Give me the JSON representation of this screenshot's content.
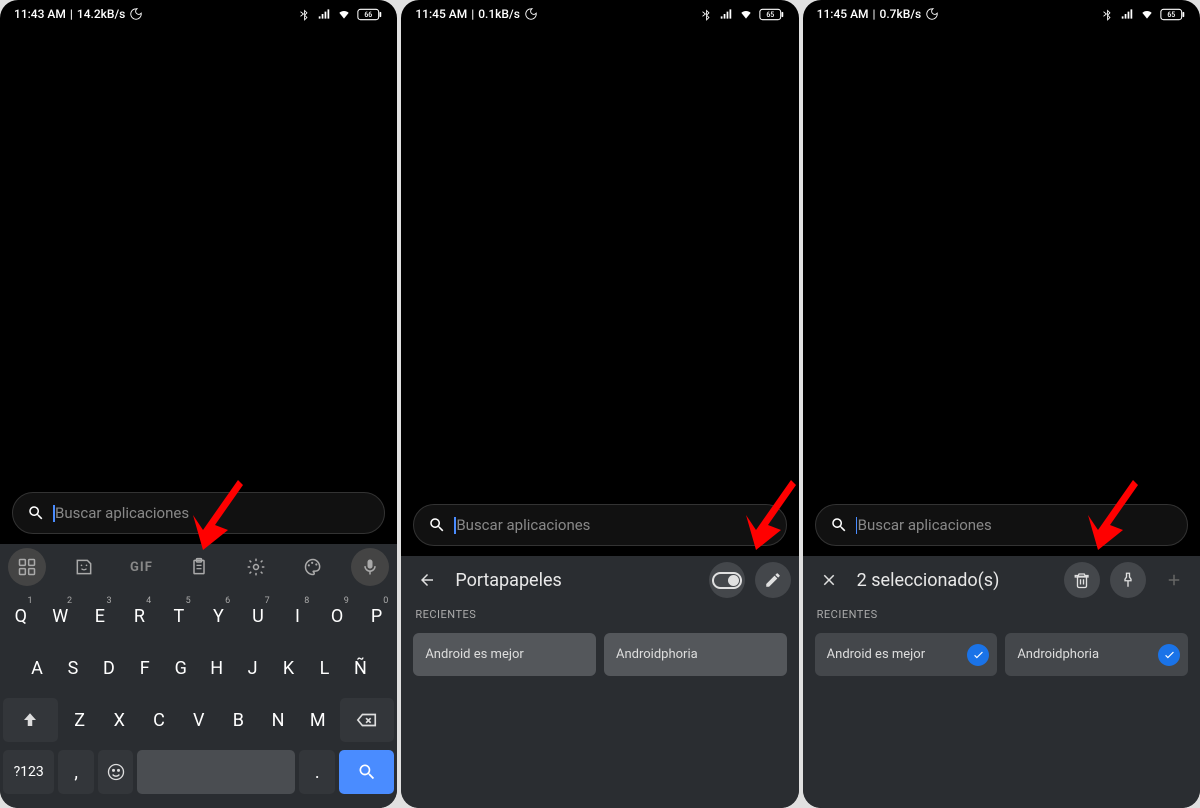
{
  "screens": [
    {
      "status": {
        "time": "11:43 AM",
        "speed": "14.2kB/s",
        "battery": "66"
      },
      "search_placeholder": "Buscar aplicaciones",
      "keyboard": {
        "row1": [
          {
            "k": "Q",
            "s": "1"
          },
          {
            "k": "W",
            "s": "2"
          },
          {
            "k": "E",
            "s": "3"
          },
          {
            "k": "R",
            "s": "4"
          },
          {
            "k": "T",
            "s": "5"
          },
          {
            "k": "Y",
            "s": "6"
          },
          {
            "k": "U",
            "s": "7"
          },
          {
            "k": "I",
            "s": "8"
          },
          {
            "k": "O",
            "s": "9"
          },
          {
            "k": "P",
            "s": "0"
          }
        ],
        "row2": [
          "A",
          "S",
          "D",
          "F",
          "G",
          "H",
          "J",
          "K",
          "L",
          "Ñ"
        ],
        "row3": [
          "Z",
          "X",
          "C",
          "V",
          "B",
          "N",
          "M"
        ],
        "sym": "?123",
        "comma": ",",
        "dot": "."
      }
    },
    {
      "status": {
        "time": "11:45 AM",
        "speed": "0.1kB/s",
        "battery": "65"
      },
      "search_placeholder": "Buscar aplicaciones",
      "clipboard": {
        "title": "Portapapeles",
        "section": "RECIENTES",
        "items": [
          "Android es mejor",
          "Androidphoria"
        ]
      }
    },
    {
      "status": {
        "time": "11:45 AM",
        "speed": "0.7kB/s",
        "battery": "65"
      },
      "search_placeholder": "Buscar aplicaciones",
      "clipboard": {
        "title": "2 seleccionado(s)",
        "section": "RECIENTES",
        "items": [
          "Android es mejor",
          "Androidphoria"
        ]
      }
    }
  ]
}
